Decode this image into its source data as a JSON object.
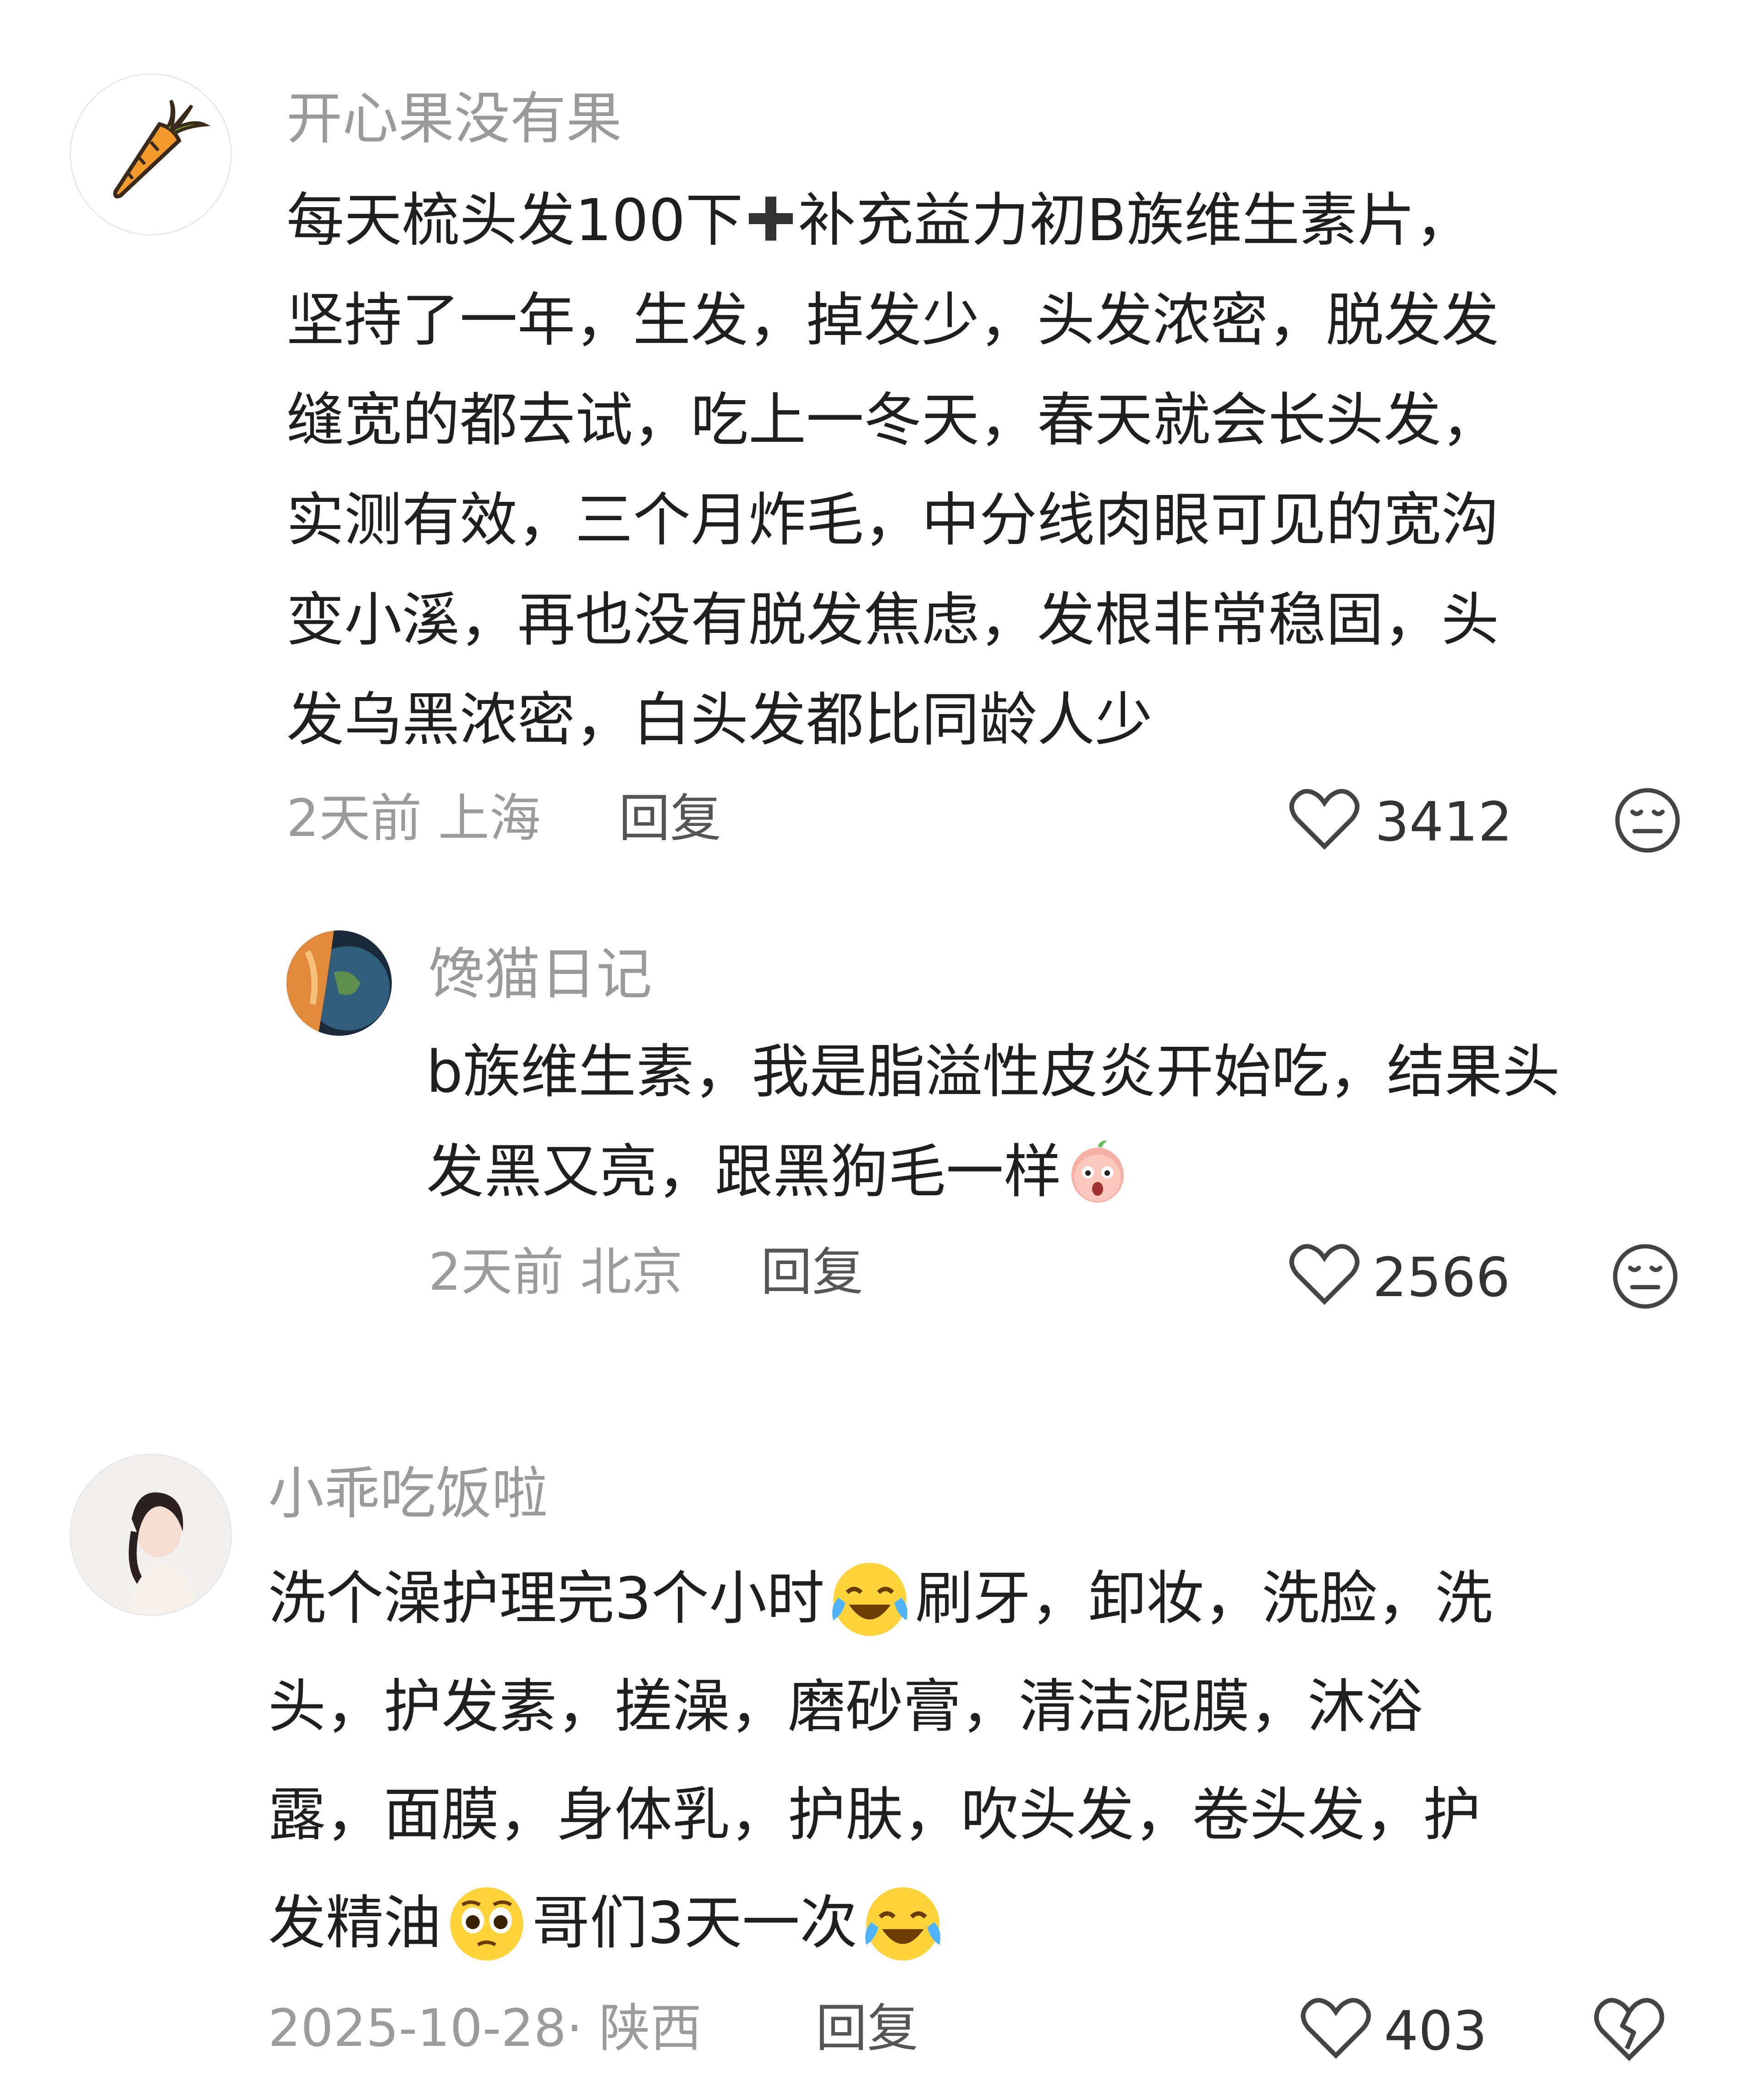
{
  "comments": [
    {
      "username": "开心果没有果",
      "avatar": "carrot-avatar",
      "lines": [
        "每天梳头发100下",
        "补充益力初B族维生素片，",
        "坚持了一年，生发，掉发少，头发浓密，脱发发",
        "缝宽的都去试，吃上一冬天，春天就会长头发，",
        "实测有效，三个月炸毛，中分线肉眼可见的宽沟",
        "变小溪，再也没有脱发焦虑，发根非常稳固，头",
        "发乌黑浓密，白头发都比同龄人少"
      ],
      "plus_icon": "plus-icon",
      "time_location": "2天前 上海",
      "reply_label": "回复",
      "likes": "3412",
      "reply": {
        "username": "馋猫日记",
        "avatar": "cat-earth-avatar",
        "line1": "b族维生素，我是脂溢性皮炎开始吃，结果头",
        "line2": "发黑又亮，跟黑狗毛一样",
        "emoji": "surprised-peach-emoji",
        "time_location": "2天前 北京",
        "reply_label": "回复",
        "likes": "2566"
      }
    },
    {
      "username": "小乖吃饭啦",
      "avatar": "girl-photo-avatar",
      "line1_a": "洗个澡护理完3个小时",
      "line1_b": "刷牙，卸妆，洗脸，洗",
      "line2": "头，护发素，搓澡，磨砂膏，清洁泥膜，沐浴",
      "line3": "露，面膜，身体乳，护肤，吹头发，卷头发，护",
      "line4_a": "发精油",
      "line4_b": "哥们3天一次",
      "emojis": [
        "crying-laughing-emoji",
        "pleading-emoji",
        "crying-laughing-emoji"
      ],
      "date_location": "2025-10-28· 陕西",
      "reply_label": "回复",
      "likes": "403"
    }
  ],
  "colors": {
    "username": "#9a9a9a",
    "text": "#1f1f1f",
    "meta": "#9b9b9b",
    "icon": "#555555"
  }
}
